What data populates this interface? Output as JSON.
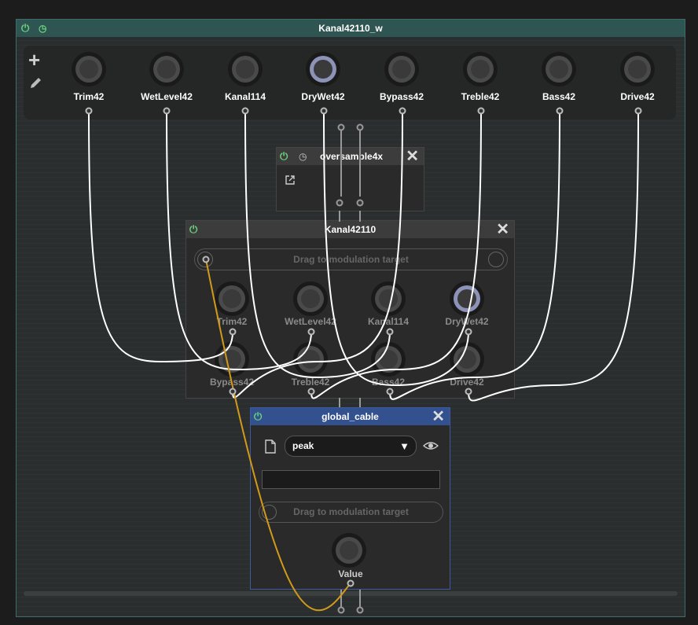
{
  "main": {
    "title": "Kanal42110_w",
    "add_label": "+",
    "knobs": [
      {
        "label": "Trim42"
      },
      {
        "label": "WetLevel42"
      },
      {
        "label": "Kanal114"
      },
      {
        "label": "DryWet42"
      },
      {
        "label": "Bypass42"
      },
      {
        "label": "Treble42"
      },
      {
        "label": "Bass42"
      },
      {
        "label": "Drive42"
      }
    ]
  },
  "oversample": {
    "title": "oversample4x",
    "close": "✕"
  },
  "kanal": {
    "title": "Kanal42110",
    "close": "✕",
    "drag_label": "Drag to modulation target",
    "knobs": [
      {
        "label": "Trim42"
      },
      {
        "label": "WetLevel42"
      },
      {
        "label": "Kanal114"
      },
      {
        "label": "DryWet42"
      },
      {
        "label": "Bypass42"
      },
      {
        "label": "Treble42"
      },
      {
        "label": "Bass42"
      },
      {
        "label": "Drive42"
      }
    ]
  },
  "global_cable": {
    "title": "global_cable",
    "close": "✕",
    "mode_value": "peak",
    "mode_arrow": "▼",
    "drag_label": "Drag to modulation target",
    "knob_label": "Value"
  },
  "colors": {
    "main_header": "#2f5552",
    "main_border": "#3e6c6a",
    "panel_header": "#3c3c3c",
    "global_header": "#33508f",
    "power_green": "#6bd17a",
    "cable_white": "#ffffff",
    "cable_orange": "#d19a1a",
    "knob_accent": "#8c93b6"
  }
}
